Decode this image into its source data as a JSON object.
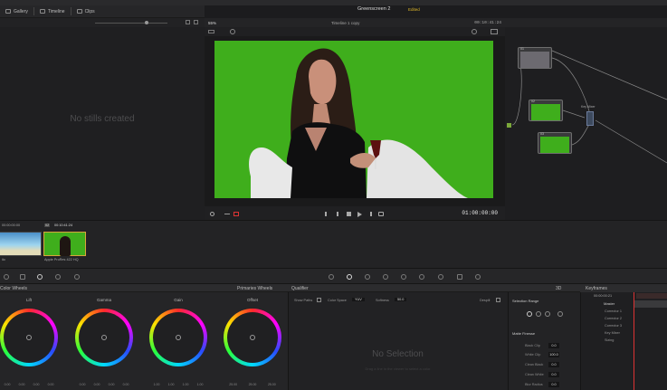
{
  "tabs": {
    "gallery": "Gallery",
    "timeline": "Timeline",
    "clips": "Clips"
  },
  "gallery": {
    "empty_text": "No stills created"
  },
  "viewer": {
    "zoom": "55%",
    "timeline_name": "Timeline 1 copy",
    "project": "Greenscreen 2",
    "status": "Edited",
    "timecode_top": "00:10:41:24",
    "timecode": "01:00:00:00"
  },
  "nodes": {
    "node1": "01",
    "node2": "02",
    "node3": "03",
    "keymixer": "Key Mixer"
  },
  "clips": {
    "clip1_tc": "00:00:00:00",
    "clip2_num": "02",
    "clip2_tc": "00:10:41:24",
    "clip1_name": "ilo",
    "clip2_name": "Apple ProRes 422 HQ"
  },
  "wheels": {
    "title": "Color Wheels",
    "mode": "Primaries Wheels",
    "lift": "Lift",
    "gamma": "Gamma",
    "gain": "Gain",
    "offset": "Offset",
    "lift_vals": [
      "0.00",
      "0.00",
      "0.00",
      "0.00"
    ],
    "gamma_vals": [
      "0.00",
      "0.00",
      "0.00",
      "0.00"
    ],
    "gain_vals": [
      "1.00",
      "1.00",
      "1.00",
      "1.00"
    ],
    "offset_vals": [
      "25.00",
      "25.00",
      "25.00"
    ]
  },
  "qualifier": {
    "title": "Qualifier",
    "mode": "3D",
    "show_paths": "Show Paths",
    "color_space": "Color Space",
    "color_space_val": "YUV",
    "softness": "Softness",
    "softness_val": "50.0",
    "despill": "Despill",
    "no_selection": "No Selection",
    "hint": "Drag a line in the viewer to select a color"
  },
  "selection": {
    "title": "Selection Range",
    "finesse": "Matte Finesse",
    "rows": [
      {
        "label": "Black Clip",
        "value": "0.0"
      },
      {
        "label": "White Clip",
        "value": "100.0"
      },
      {
        "label": "Clean Black",
        "value": "0.0"
      },
      {
        "label": "Clean White",
        "value": "0.0"
      },
      {
        "label": "Blur Radius",
        "value": "0.0"
      }
    ]
  },
  "keyframes": {
    "title": "Keyframes",
    "timecode": "00:00:00:21",
    "master": "Master",
    "items": [
      "Corrector 1",
      "Corrector 2",
      "Corrector 3",
      "Key Mixer",
      "Sizing"
    ]
  }
}
